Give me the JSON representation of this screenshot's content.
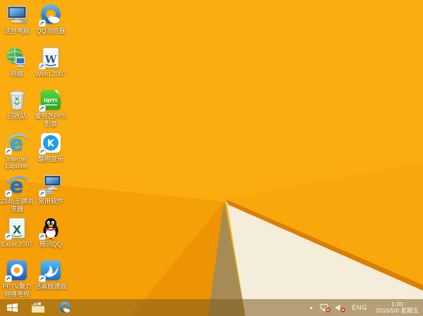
{
  "desktop": {
    "icons": [
      {
        "id": "this-pc",
        "label": "这台电脑",
        "col": 1,
        "row": 1,
        "shortcut": false,
        "type": "computer",
        "icon_name": "computer-icon"
      },
      {
        "id": "qq-browser",
        "label": "QQ浏览器",
        "col": 2,
        "row": 1,
        "shortcut": true,
        "type": "qqbrowser",
        "icon_name": "qq-browser-icon"
      },
      {
        "id": "network",
        "label": "网络",
        "col": 1,
        "row": 2,
        "shortcut": false,
        "type": "network",
        "icon_name": "network-globe-icon"
      },
      {
        "id": "word-2007",
        "label": "Word 2007",
        "col": 2,
        "row": 2,
        "shortcut": true,
        "type": "word",
        "icon_name": "word-document-icon"
      },
      {
        "id": "recycle-bin",
        "label": "回收站",
        "col": 1,
        "row": 3,
        "shortcut": false,
        "type": "recycle",
        "icon_name": "recycle-bin-icon"
      },
      {
        "id": "iqiyi-pps",
        "label": "爱奇艺PPS 影音",
        "col": 2,
        "row": 3,
        "shortcut": true,
        "type": "iqiyi",
        "icon_name": "iqiyi-pps-icon"
      },
      {
        "id": "internet-explorer",
        "label": "Internet Explorer",
        "col": 1,
        "row": 4,
        "shortcut": true,
        "type": "ie",
        "icon_name": "internet-explorer-icon"
      },
      {
        "id": "kugou-music",
        "label": "酷狗音乐",
        "col": 2,
        "row": 4,
        "shortcut": true,
        "type": "kugou",
        "icon_name": "kugou-music-icon"
      },
      {
        "id": "browser-2345",
        "label": "2345王牌浏览器",
        "col": 1,
        "row": 5,
        "shortcut": true,
        "type": "browser2345",
        "icon_name": "2345-browser-icon"
      },
      {
        "id": "common-software",
        "label": "常用软件",
        "col": 2,
        "row": 5,
        "shortcut": true,
        "type": "devices",
        "icon_name": "computer-devices-icon"
      },
      {
        "id": "excel-2007",
        "label": "Excel 2007",
        "col": 1,
        "row": 6,
        "shortcut": true,
        "type": "excel",
        "icon_name": "excel-spreadsheet-icon"
      },
      {
        "id": "tencent-qq",
        "label": "腾讯QQ",
        "col": 2,
        "row": 6,
        "shortcut": true,
        "type": "qq",
        "icon_name": "qq-penguin-icon"
      },
      {
        "id": "pptv",
        "label": "PPTV聚力 网络电视",
        "col": 1,
        "row": 7,
        "shortcut": true,
        "type": "pptv",
        "icon_name": "pptv-icon"
      },
      {
        "id": "xunlei",
        "label": "迅雷极速版",
        "col": 2,
        "row": 7,
        "shortcut": true,
        "type": "xunlei",
        "icon_name": "xunlei-thunder-icon"
      }
    ]
  },
  "taskbar": {
    "pinned": [
      {
        "id": "explorer",
        "type": "explorer",
        "icon_name": "file-explorer-icon"
      },
      {
        "id": "qq-browser",
        "type": "qqbrowser",
        "icon_name": "qq-browser-icon"
      }
    ],
    "tray": {
      "chevron": "▲",
      "language": "ENG",
      "time": "1:00",
      "date": "2016/5/6 星期五"
    }
  },
  "colors": {
    "wp-base": "#FBAD10",
    "wp-facet-left": "#F6A007",
    "wp-facet-deep": "#EE9303",
    "wp-shadow": "#A68C54",
    "wp-cream": "#F3EDDA",
    "wp-edge": "#DC7E02",
    "taskbar-tint": "rgba(122,88,28,0.52)",
    "label-color": "#FFFFFF",
    "tray-text": "#FFF6DE"
  }
}
